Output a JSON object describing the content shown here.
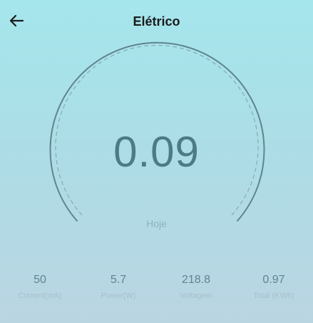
{
  "header": {
    "title": "Elétrico"
  },
  "icons": {
    "back": "arrow-left-icon"
  },
  "gauge": {
    "value": "0.09",
    "label": "Hoje"
  },
  "stats": [
    {
      "value": "50",
      "label": "Current(mA)"
    },
    {
      "value": "5.7",
      "label": "Power(W)"
    },
    {
      "value": "218.8",
      "label": "Voltagem"
    },
    {
      "value": "0.97",
      "label": "Total (KWh)"
    }
  ],
  "colors": {
    "gauge_arc": "#5f8590",
    "gauge_dashed": "#86aab3",
    "value_text": "#4d7a85"
  }
}
